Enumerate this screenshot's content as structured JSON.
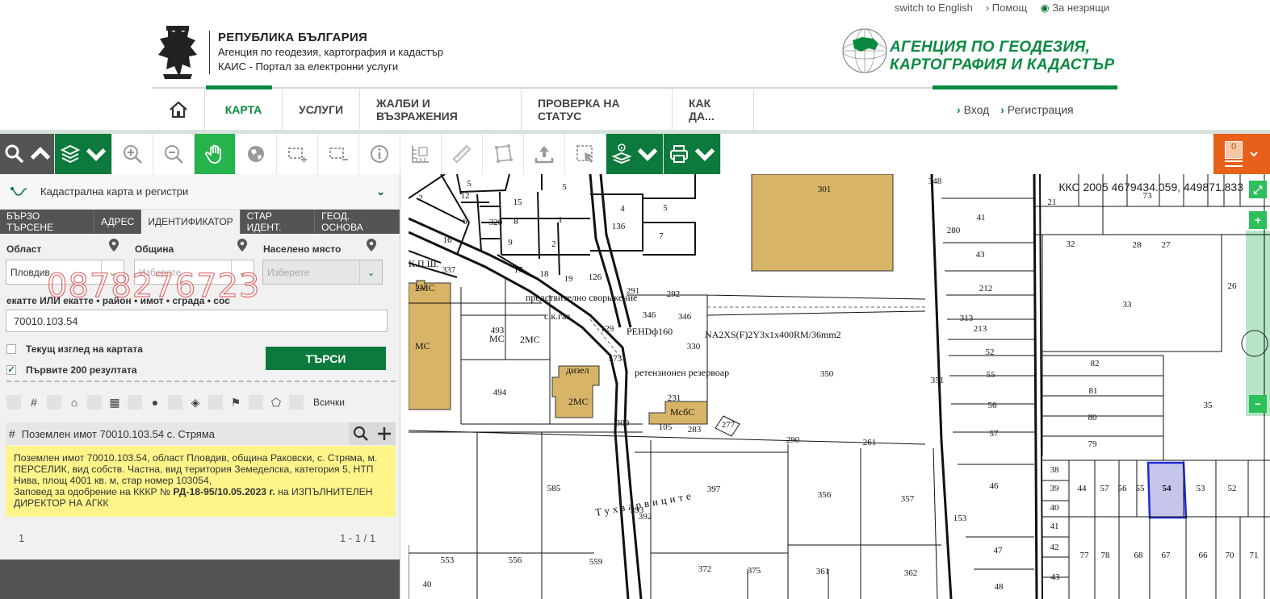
{
  "top_links": {
    "english": "switch to English",
    "help": "Помощ",
    "visually_impaired": "За незрящи"
  },
  "header": {
    "title": "РЕПУБЛИКА БЪЛГАРИЯ",
    "subtitle": "Агенция по геодезия, картография и кадастър",
    "portal": "КАИС - Портал за електронни услуги",
    "agency_line1": "АГЕНЦИЯ ПО ГЕОДЕЗИЯ,",
    "agency_line2": "КАРТОГРАФИЯ И КАДАСТЪР"
  },
  "nav": {
    "items": [
      "КАРТА",
      "УСЛУГИ",
      "ЖАЛБИ И ВЪЗРАЖЕНИЯ",
      "ПРОВЕРКА НА СТАТУС",
      "КАК ДА..."
    ],
    "active": "КАРТА",
    "login": "Вход",
    "register": "Регистрация"
  },
  "toolbar": {
    "icons": [
      "search-icon",
      "layers-icon",
      "zoom-in-icon",
      "zoom-out-icon",
      "pan-hand-icon",
      "globe-icon",
      "add-rect-icon",
      "remove-rect-icon",
      "info-icon",
      "measure-grid-icon",
      "ruler-icon",
      "polygon-icon",
      "upload-icon",
      "select-icon",
      "identify-layers-icon",
      "print-icon"
    ],
    "cart_count": "0"
  },
  "panel": {
    "title": "Кадастрална карта и регистри",
    "tabs": [
      "БЪРЗО ТЪРСЕНЕ",
      "АДРЕС",
      "ИДЕНТИФИКАТОР",
      "СТАР ИДЕНТ.",
      "ГЕОД. ОСНОВА"
    ],
    "active_tab": "ИДЕНТИФИКАТОР",
    "region_label": "Област",
    "municipality_label": "Община",
    "settlement_label": "Населено място",
    "region_value": "Пловдив",
    "municipality_placeholder": "Изберете",
    "settlement_placeholder": "Изберете",
    "watermark": "0878276723",
    "ekatte_label": "екатте ИЛИ екатте • район • имот • сграда • сос",
    "ekatte_value": "70010.103.54",
    "current_view_label": "Текущ изглед на картата",
    "first200_label": "Първите 200 резултата",
    "search_button": "ТЪРСИ",
    "filter_all": "Всички",
    "result_title": "Поземлен имот 70010.103.54 с. Стряма",
    "result_line1": "Поземлен имот 70010.103.54, област Пловдив, община Раковски, с. Стряма, м.",
    "result_line2": "ПЕРСЕЛИК, вид собств. Частна, вид територия Земеделска, категория 5, НТП",
    "result_line3": "Нива, площ 4001 кв. м, стар номер 103054,",
    "result_line4a": "Заповед за одобрение на КККР № ",
    "result_line4b": "РД-18-95/10.05.2023 г.",
    "result_line4c": " на ИЗПЪЛНИТЕЛЕН",
    "result_line5": "ДИРЕКТОР НА АГКК",
    "page": "1",
    "page_range": "1 - 1 / 1"
  },
  "map": {
    "coords": "ККС 2005 4679434.059, 449871.833",
    "labels": {
      "preds": "предствително сворьжение",
      "gaz": "с.к.газ",
      "dizel": "дизел",
      "rez": "ретензионен резервоар",
      "cable": "NA2XS(F)2Y3x1x400RM/36mm2",
      "pehd": "PEHDф160",
      "region": "Тухзарвиците",
      "mcbc": "МсбС",
      "ms": "МС",
      "ms2": "2МС",
      "kpsh": "К.П.Ш."
    },
    "numbers": [
      "2",
      "5",
      "12",
      "5",
      "15",
      "6",
      "320",
      "8",
      "1",
      "4",
      "5",
      "136",
      "7",
      "16",
      "9",
      "2",
      "337",
      "17",
      "18",
      "19",
      "126",
      "291",
      "292",
      "301",
      "348",
      "21",
      "73",
      "280",
      "41",
      "32",
      "28",
      "27",
      "43",
      "212",
      "213",
      "26",
      "33",
      "52",
      "55",
      "56",
      "57",
      "82",
      "81",
      "80",
      "79",
      "35",
      "46",
      "47",
      "48",
      "493",
      "494",
      "129",
      "573",
      "330",
      "350",
      "351",
      "231",
      "283",
      "277",
      "290",
      "261",
      "585",
      "397",
      "356",
      "357",
      "553",
      "556",
      "559",
      "372",
      "375",
      "361",
      "362",
      "393",
      "392",
      "153",
      "38",
      "39",
      "40",
      "41",
      "42",
      "43",
      "44",
      "57",
      "56",
      "55",
      "54",
      "53",
      "52",
      "77",
      "78",
      "68",
      "67",
      "66",
      "70",
      "71",
      "346",
      "346",
      "313",
      "105",
      "309",
      "40"
    ],
    "highlight": "54"
  },
  "colors": {
    "brand_green": "#0a8a40",
    "dark_green": "#0b7a3c",
    "toolbar_gray": "#545454",
    "orange": "#e8611a",
    "result_yellow": "#fdf58a",
    "building": "#d8b468"
  }
}
